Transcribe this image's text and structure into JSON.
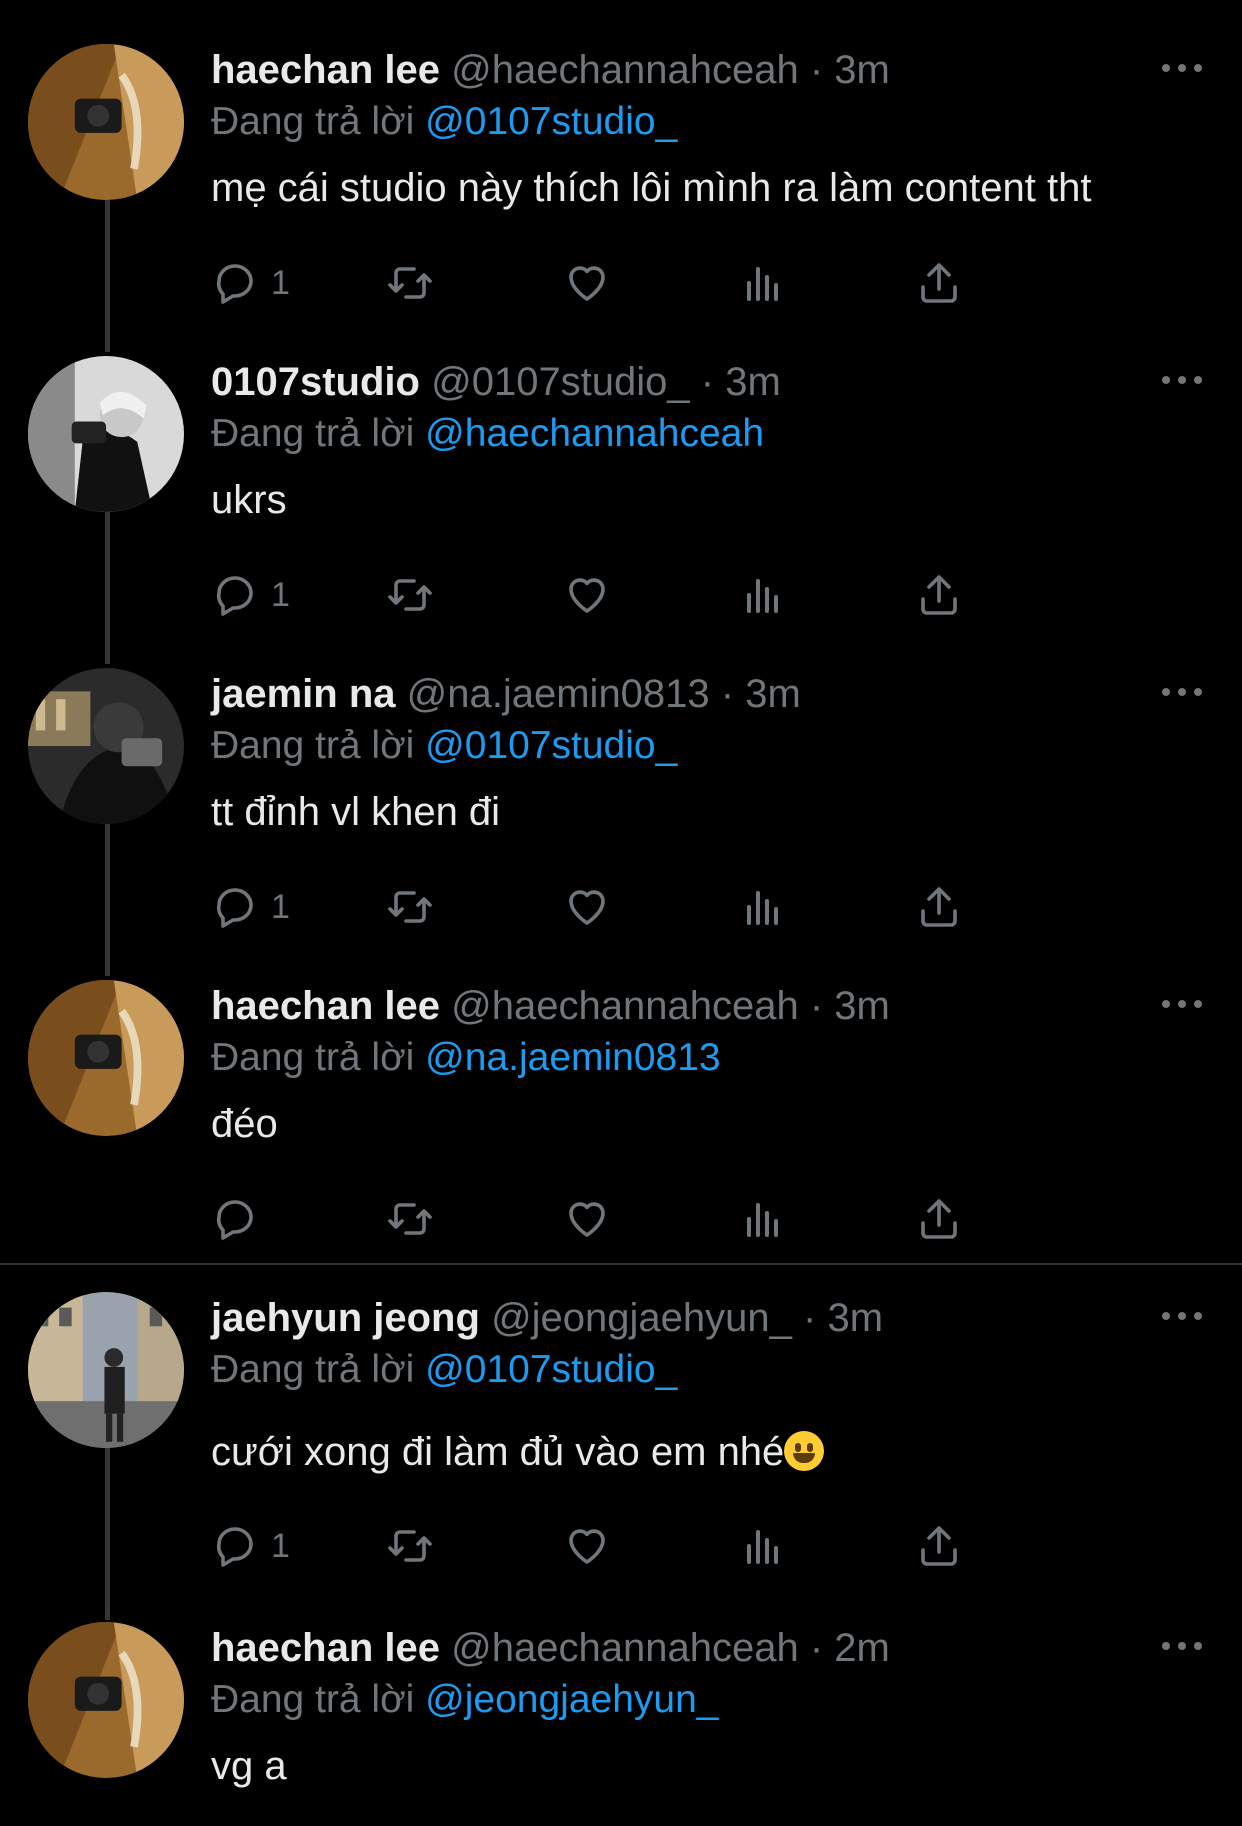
{
  "tweets": [
    {
      "name": "haechan lee",
      "handle": "@haechannahceah",
      "time": "3m",
      "reply_prefix": "Đang trả lời",
      "reply_to": "@0107studio_",
      "text": "mẹ cái studio này thích lôi mình ra làm content tht",
      "reply_count": "1",
      "avatar": "avatar-haechan"
    },
    {
      "name": "0107studio",
      "handle": "@0107studio_",
      "time": "3m",
      "reply_prefix": "Đang trả lời",
      "reply_to": "@haechannahceah",
      "text": "ukrs",
      "reply_count": "1",
      "avatar": "avatar-studio"
    },
    {
      "name": "jaemin na",
      "handle": "@na.jaemin0813",
      "time": "3m",
      "reply_prefix": "Đang trả lời",
      "reply_to": "@0107studio_",
      "text": "tt đỉnh vl khen đi",
      "reply_count": "1",
      "avatar": "avatar-jaemin"
    },
    {
      "name": "haechan lee",
      "handle": "@haechannahceah",
      "time": "3m",
      "reply_prefix": "Đang trả lời",
      "reply_to": "@na.jaemin0813",
      "text": "đéo",
      "reply_count": "",
      "avatar": "avatar-haechan"
    },
    {
      "name": "jaehyun jeong",
      "handle": "@jeongjaehyun_",
      "time": "3m",
      "reply_prefix": "Đang trả lời",
      "reply_to": "@0107studio_",
      "text": "cưới xong đi làm đủ vào em nhé",
      "emoji": "grinning-face",
      "reply_count": "1",
      "avatar": "avatar-jaehyun"
    },
    {
      "name": "haechan lee",
      "handle": "@haechannahceah",
      "time": "2m",
      "reply_prefix": "Đang trả lời",
      "reply_to": "@jeongjaehyun_",
      "text": "vg a",
      "reply_count": "",
      "avatar": "avatar-haechan"
    }
  ],
  "separator": "·",
  "icons": {
    "reply": "reply-icon",
    "retweet": "retweet-icon",
    "like": "heart-icon",
    "views": "views-icon",
    "share": "share-icon",
    "more": "more-icon"
  },
  "colors": {
    "background": "#000000",
    "primary_text": "#e7e9ea",
    "secondary_text": "#71767b",
    "mention": "#1d9bf0",
    "divider": "#2f3336"
  }
}
